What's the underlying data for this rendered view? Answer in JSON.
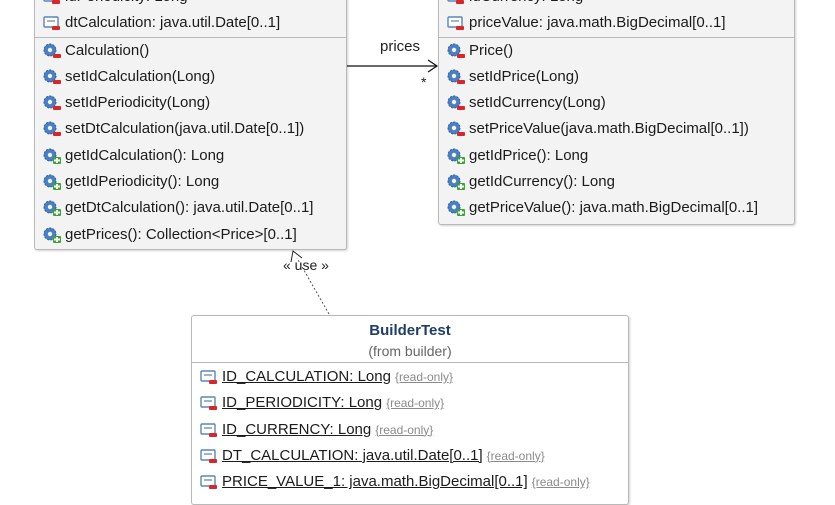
{
  "calculation_class": {
    "attributes": [
      {
        "text": "idPeriodicity: Long",
        "icon": "field-icon"
      },
      {
        "text": "dtCalculation: java.util.Date[0..1]",
        "icon": "field-icon"
      }
    ],
    "operations": [
      {
        "text": "Calculation()",
        "icon": "private-method-icon"
      },
      {
        "text": "setIdCalculation(Long)",
        "icon": "private-method-icon"
      },
      {
        "text": "setIdPeriodicity(Long)",
        "icon": "private-method-icon"
      },
      {
        "text": "setDtCalculation(java.util.Date[0..1])",
        "icon": "private-method-icon"
      },
      {
        "text": "getIdCalculation(): Long",
        "icon": "public-method-icon"
      },
      {
        "text": "getIdPeriodicity(): Long",
        "icon": "public-method-icon"
      },
      {
        "text": "getDtCalculation(): java.util.Date[0..1]",
        "icon": "public-method-icon"
      },
      {
        "text": "getPrices(): Collection<Price>[0..1]",
        "icon": "public-method-icon"
      }
    ]
  },
  "price_class": {
    "attributes": [
      {
        "text": "idCurrency: Long",
        "icon": "field-icon"
      },
      {
        "text": "priceValue: java.math.BigDecimal[0..1]",
        "icon": "field-icon"
      }
    ],
    "operations": [
      {
        "text": "Price()",
        "icon": "private-method-icon"
      },
      {
        "text": "setIdPrice(Long)",
        "icon": "private-method-icon"
      },
      {
        "text": "setIdCurrency(Long)",
        "icon": "private-method-icon"
      },
      {
        "text": "setPriceValue(java.math.BigDecimal[0..1])",
        "icon": "private-method-icon"
      },
      {
        "text": "getIdPrice(): Long",
        "icon": "public-method-icon"
      },
      {
        "text": "getIdCurrency(): Long",
        "icon": "public-method-icon"
      },
      {
        "text": "getPriceValue(): java.math.BigDecimal[0..1]",
        "icon": "public-method-icon"
      }
    ]
  },
  "association": {
    "role_label": "prices",
    "multiplicity": "*"
  },
  "dependency": {
    "stereotype": "« use »"
  },
  "builder_class": {
    "name": "BuilderTest",
    "package_note": "(from builder)",
    "read_only_tag": "{read-only}",
    "attributes": [
      {
        "text": "ID_CALCULATION: Long",
        "icon": "static-field-icon"
      },
      {
        "text": "ID_PERIODICITY: Long",
        "icon": "static-field-icon"
      },
      {
        "text": "ID_CURRENCY: Long",
        "icon": "static-field-icon"
      },
      {
        "text": "DT_CALCULATION: java.util.Date[0..1]",
        "icon": "static-field-icon"
      },
      {
        "text": "PRICE_VALUE_1: java.math.BigDecimal[0..1]",
        "icon": "static-field-icon"
      }
    ]
  },
  "colors": {
    "gear": "#4a7fc4",
    "gear_hole": "#f3f3f3",
    "private_badge": "#d9262b",
    "public_badge": "#3aa62f",
    "field_icon_border": "#5a86b8",
    "class_name": "#1f3d66"
  }
}
